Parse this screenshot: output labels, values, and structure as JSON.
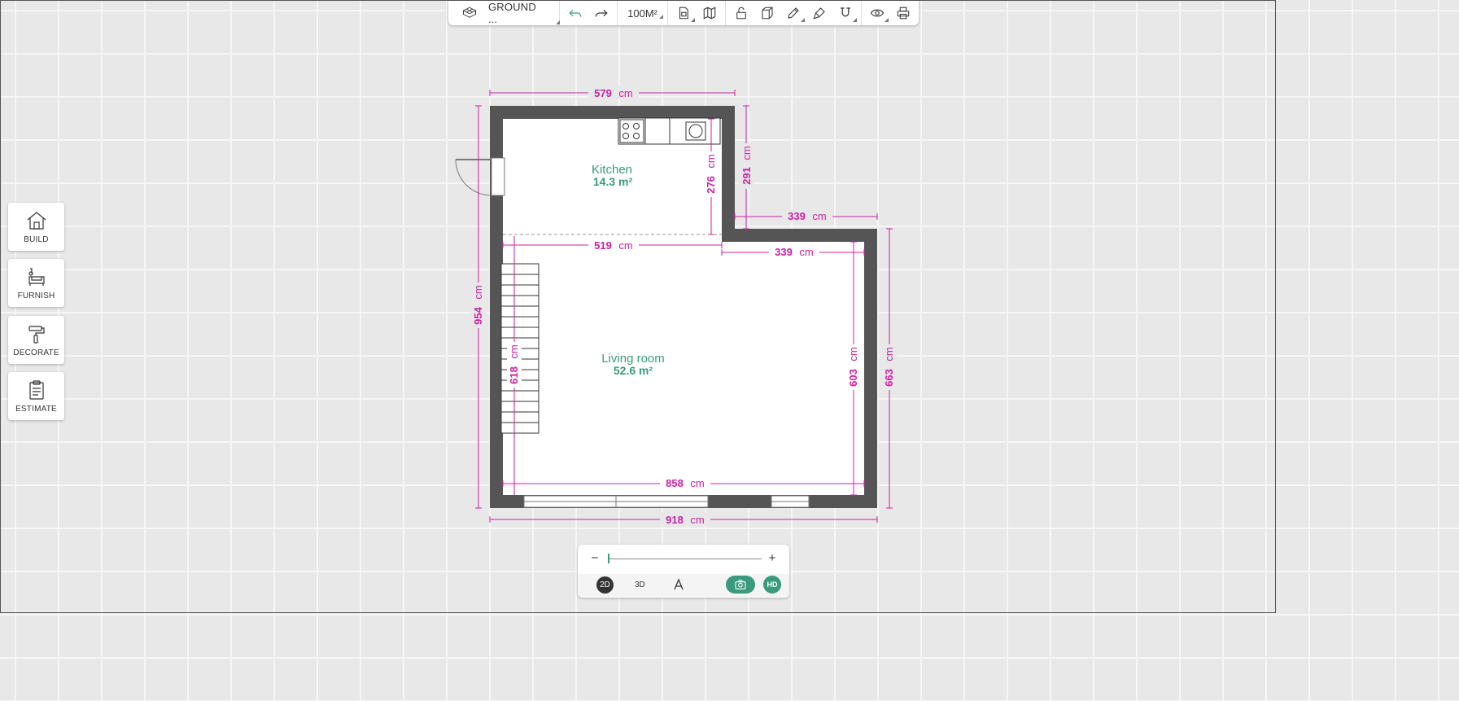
{
  "toolbar": {
    "floor_label": "GROUND ...",
    "area_label": "100M²",
    "icons": [
      "floor-3d-icon",
      "undo-icon",
      "redo-icon",
      "document-icon",
      "map-icon",
      "unlock-icon",
      "cube-icon",
      "pencil-icon",
      "paint-marker-icon",
      "magnet-icon",
      "eye-icon",
      "print-icon"
    ]
  },
  "sidebar": {
    "items": [
      {
        "label": "BUILD",
        "icon": "house-icon"
      },
      {
        "label": "FURNISH",
        "icon": "sofa-icon"
      },
      {
        "label": "DECORATE",
        "icon": "paint-roller-icon"
      },
      {
        "label": "ESTIMATE",
        "icon": "clipboard-icon"
      }
    ]
  },
  "rooms": [
    {
      "name": "Kitchen",
      "area": "14.3 m²"
    },
    {
      "name": "Living room",
      "area": "52.6 m²"
    }
  ],
  "dimensions": {
    "d579": "579",
    "d291": "291",
    "d276": "276",
    "d339a": "339",
    "d339b": "339",
    "d519": "519",
    "d954": "954",
    "d618": "618",
    "d603": "603",
    "d663": "663",
    "d858": "858",
    "d918": "918",
    "unit": "cm"
  },
  "colors": {
    "accent": "#3a9a7d",
    "dimension": "#cc1fa3",
    "wall": "#555555"
  },
  "view": {
    "mode_2d": "2D",
    "mode_3d": "3D",
    "hd": "HD",
    "zoom_minus": "−",
    "zoom_plus": "+"
  }
}
